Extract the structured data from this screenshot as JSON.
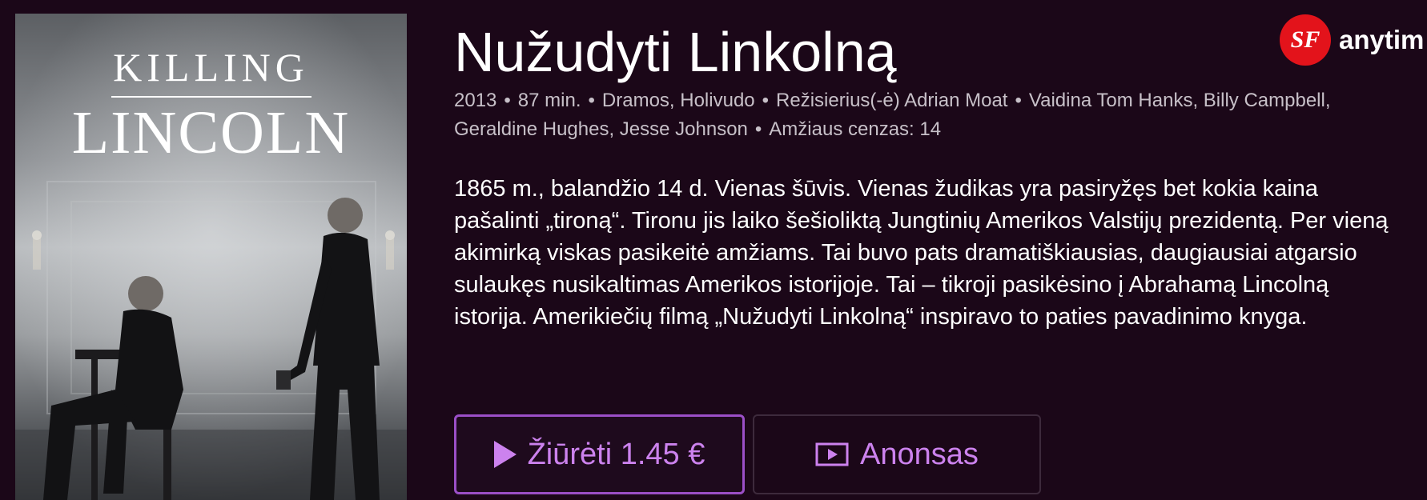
{
  "poster": {
    "title_line1": "KILLING",
    "title_line2": "LINCOLN"
  },
  "brand": {
    "logo_mark": "SF",
    "name": "anytim",
    "color": "#e3131b"
  },
  "movie": {
    "title": "Nužudyti Linkolną",
    "meta": [
      "2013",
      "87 min.",
      "Dramos, Holivudo",
      "Režisierius(-ė) Adrian Moat",
      "Vaidina Tom Hanks, Billy Campbell, Geraldine Hughes, Jesse Johnson",
      "Amžiaus cenzas: 14"
    ],
    "meta_separator": "•",
    "description": "1865 m., balandžio 14 d. Vienas šūvis. Vienas žudikas yra pasiryžęs bet kokia kaina pašalinti „tironą“. Tironu jis laiko šešioliktą Jungtinių Amerikos Valstijų prezidentą. Per vieną akimirką viskas pasikeitė amžiams. Tai buvo pats dramatiškiausias, daugiausiai atgarsio sulaukęs nusikaltimas Amerikos istorijoje. Tai – tikroji pasikėsino į Abrahamą Lincolną istorija. Amerikiečių filmą „Nužudyti Linkolną“ inspiravo to paties pavadinimo knyga."
  },
  "actions": {
    "watch_label": "Žiūrėti 1.45 €",
    "watch_icon": "play-icon",
    "trailer_label": "Anonsas",
    "trailer_icon": "trailer-icon"
  },
  "colors": {
    "background": "#1b0718",
    "accent": "#cc82ee",
    "accent_border": "#9b4fc7",
    "meta_text": "#c7c0c8"
  }
}
